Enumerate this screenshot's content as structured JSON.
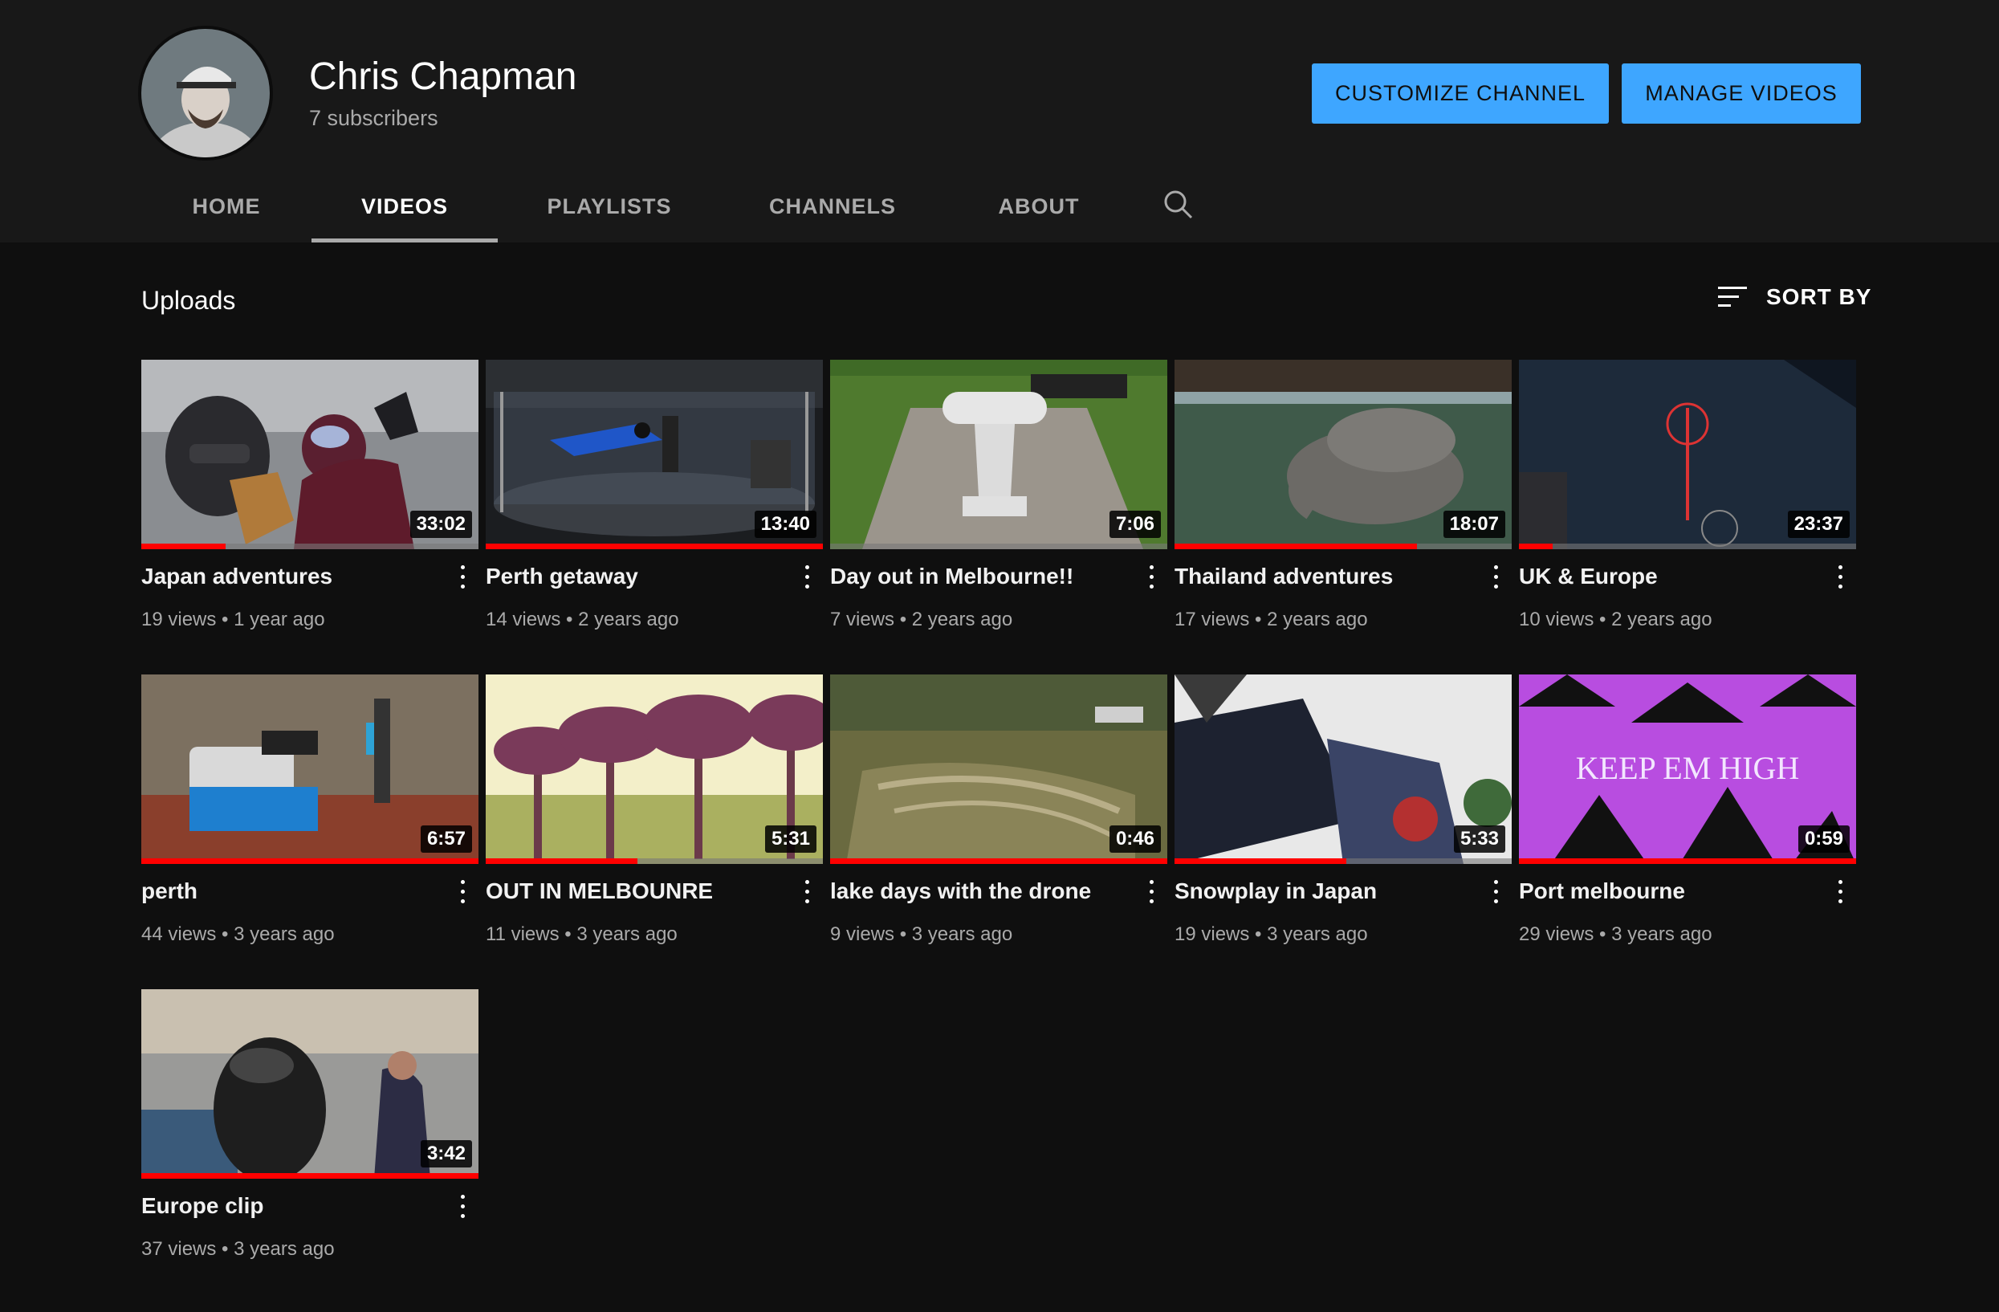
{
  "channel": {
    "name": "Chris Chapman",
    "subscribers": "7 subscribers",
    "avatar_icon": "avatar-photo"
  },
  "buttons": {
    "customize": "CUSTOMIZE CHANNEL",
    "manage": "MANAGE VIDEOS"
  },
  "colors": {
    "accent": "#3ea6ff",
    "progress": "#ff0000",
    "background": "#0f0f0f",
    "header": "#181818"
  },
  "tabs": [
    {
      "label": "HOME",
      "active": false
    },
    {
      "label": "VIDEOS",
      "active": true
    },
    {
      "label": "PLAYLISTS",
      "active": false
    },
    {
      "label": "CHANNELS",
      "active": false
    },
    {
      "label": "ABOUT",
      "active": false
    }
  ],
  "search_icon": "search-icon",
  "section": {
    "title": "Uploads",
    "sort_label": "SORT BY",
    "sort_icon": "sort-icon"
  },
  "videos": [
    {
      "title": "Japan adventures",
      "views": "19 views",
      "age": "1 year ago",
      "duration": "33:02",
      "watched": 0.25
    },
    {
      "title": "Perth getaway",
      "views": "14 views",
      "age": "2 years ago",
      "duration": "13:40",
      "watched": 1.0
    },
    {
      "title": "Day out in Melbourne!!",
      "views": "7 views",
      "age": "2 years ago",
      "duration": "7:06",
      "watched": 0.0
    },
    {
      "title": "Thailand adventures",
      "views": "17 views",
      "age": "2 years ago",
      "duration": "18:07",
      "watched": 0.72
    },
    {
      "title": "UK & Europe",
      "views": "10 views",
      "age": "2 years ago",
      "duration": "23:37",
      "watched": 0.1
    },
    {
      "title": "perth",
      "views": "44 views",
      "age": "3 years ago",
      "duration": "6:57",
      "watched": 1.0
    },
    {
      "title": "OUT IN MELBOUNRE",
      "views": "11 views",
      "age": "3 years ago",
      "duration": "5:31",
      "watched": 0.45
    },
    {
      "title": "lake days with the drone",
      "views": "9 views",
      "age": "3 years ago",
      "duration": "0:46",
      "watched": 1.0
    },
    {
      "title": "Snowplay in Japan",
      "views": "19 views",
      "age": "3 years ago",
      "duration": "5:33",
      "watched": 0.51
    },
    {
      "title": "Port melbourne",
      "views": "29 views",
      "age": "3 years ago",
      "duration": "0:59",
      "watched": 1.0,
      "thumb_text": "KEEP EM HIGH"
    },
    {
      "title": "Europe clip",
      "views": "37 views",
      "age": "3 years ago",
      "duration": "3:42",
      "watched": 1.0
    }
  ]
}
